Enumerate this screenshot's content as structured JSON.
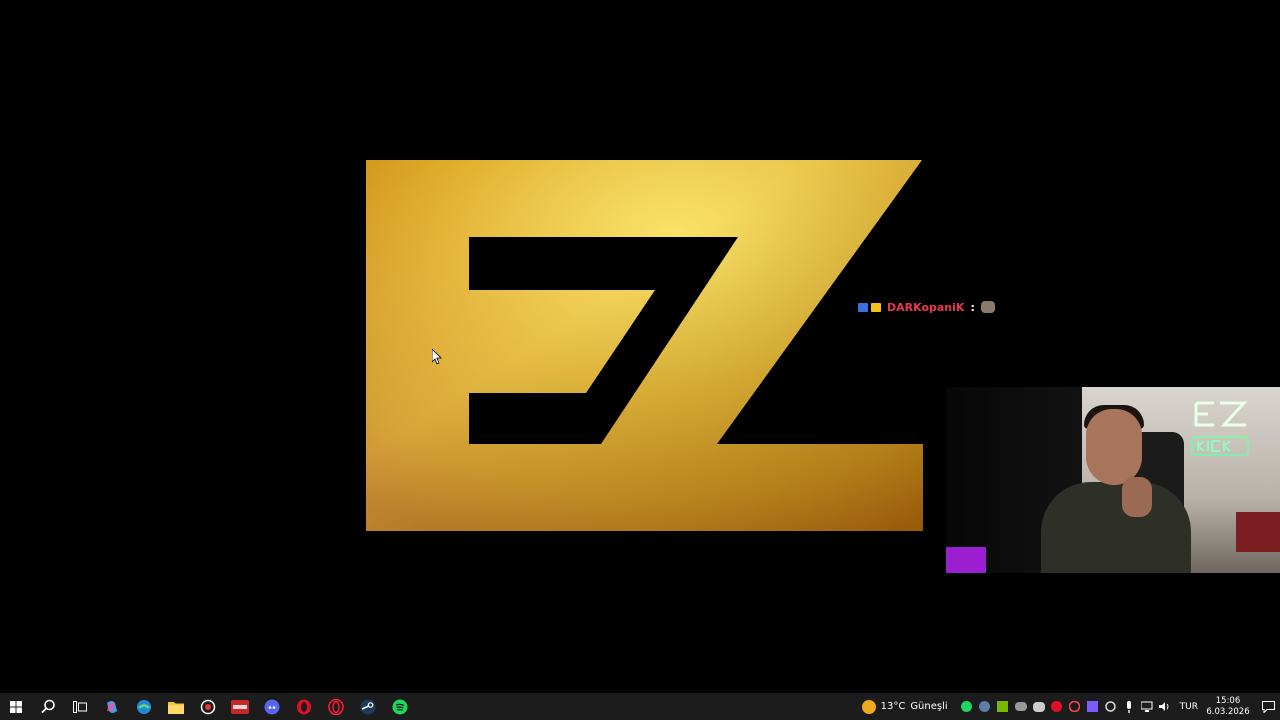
{
  "chat": {
    "username": "DARKopaniK",
    "separator": ":"
  },
  "taskbar": {
    "apps": [
      "windows-start",
      "search",
      "task-view",
      "copilot",
      "edge",
      "file-explorer",
      "screen-recorder",
      "voice-app",
      "discord",
      "opera-gx",
      "opera",
      "steam",
      "spotify"
    ],
    "weather_temp": "13°C",
    "weather_text": "Güneşli",
    "language": "TUR",
    "time": "15:06",
    "date": "6.03.2026"
  },
  "colors": {
    "gold": "#d8a21c",
    "chat_username": "#e8384f",
    "taskbar_bg": "#1c1c1c"
  }
}
